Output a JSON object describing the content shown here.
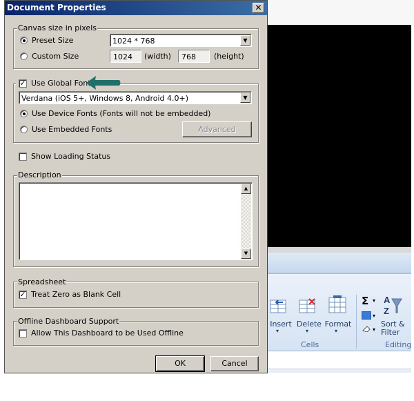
{
  "dialog": {
    "title": "Document Properties",
    "close_glyph": "✕",
    "canvas_group": {
      "legend": "Canvas size in pixels",
      "preset_label": "Preset Size",
      "preset_value": "1024 * 768",
      "custom_label": "Custom Size",
      "width_value": "1024",
      "width_label": "(width)",
      "height_value": "768",
      "height_label": "(height)"
    },
    "font_group": {
      "use_global_font": "Use Global Font",
      "font_value": "Verdana (iOS 5+, Windows 8, Android 4.0+)",
      "device_fonts": "Use Device Fonts (Fonts will not be embedded)",
      "embedded_fonts": "Use Embedded Fonts",
      "advanced": "Advanced"
    },
    "show_loading": "Show Loading Status",
    "description": {
      "legend": "Description"
    },
    "spreadsheet": {
      "legend": "Spreadsheet",
      "treat_zero": "Treat Zero as Blank Cell"
    },
    "offline": {
      "legend": "Offline Dashboard Support",
      "allow": "Allow This Dashboard to be Used Offline"
    },
    "ok": "OK",
    "cancel": "Cancel"
  },
  "ribbon": {
    "insert": "Insert",
    "delete": "Delete",
    "format": "Format",
    "cells_group": "Cells",
    "sum_glyph": "Σ",
    "sort_filter": "Sort &",
    "filter": "Filter",
    "editing_group": "Editing"
  },
  "colors": {
    "title_bar": "#0a246a",
    "dialog_face": "#d4d0c8",
    "annotation_arrow": "#1f6f6a"
  }
}
